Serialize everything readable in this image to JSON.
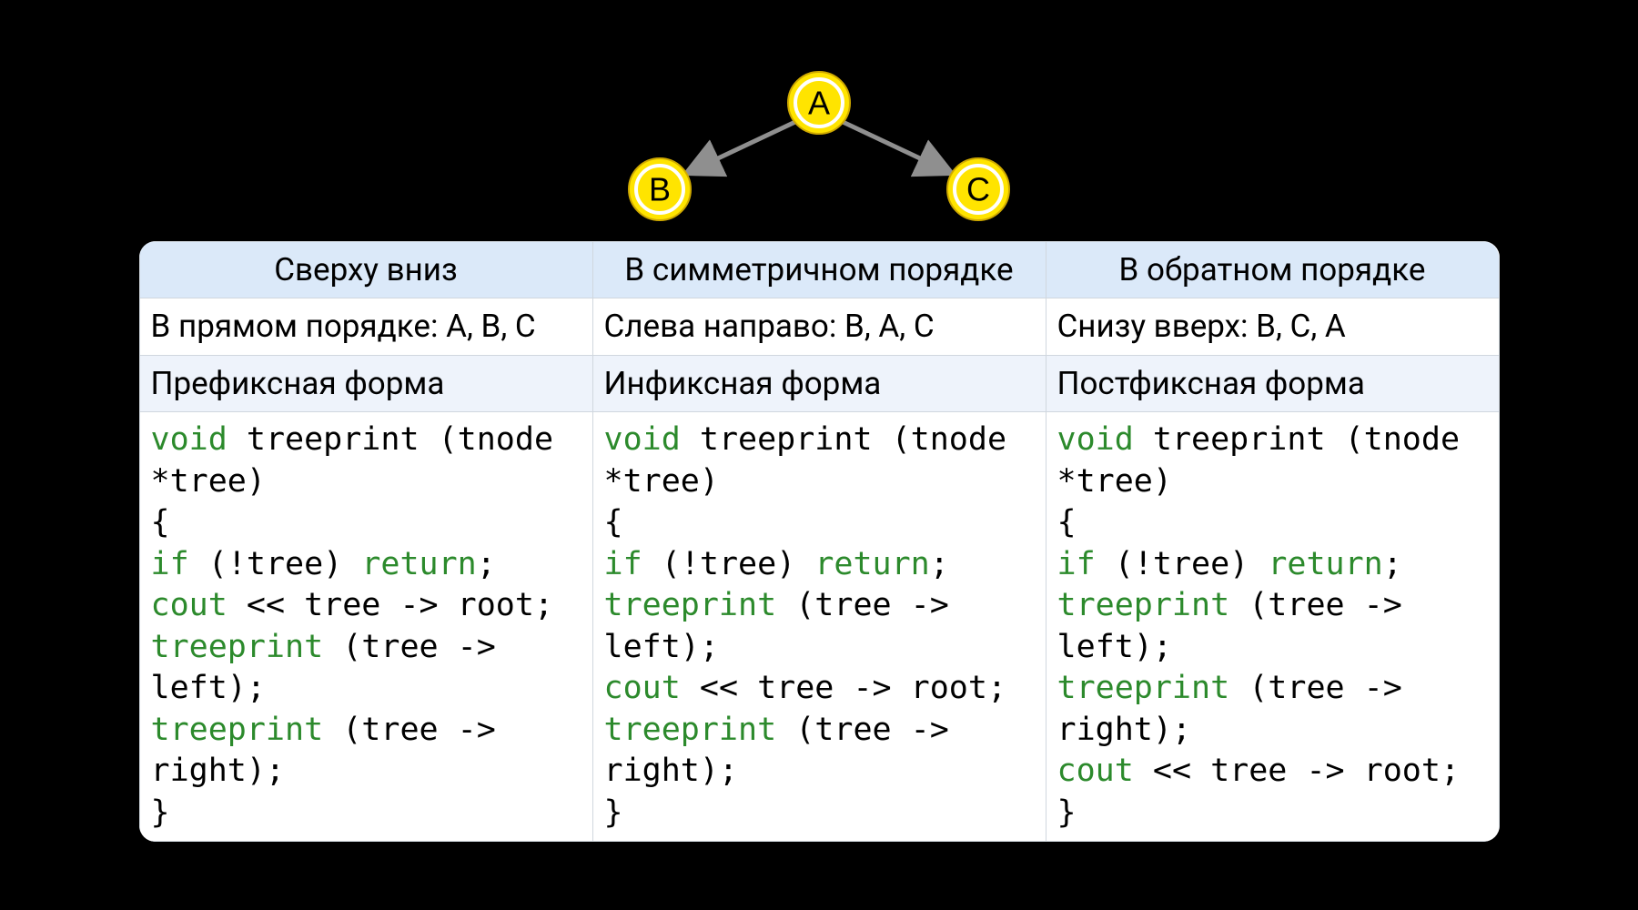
{
  "tree": {
    "root": "A",
    "left": "B",
    "right": "C"
  },
  "columns": [
    {
      "header": "Сверху вниз",
      "desc": "В прямом порядке: A, B, C",
      "form": "Префиксная форма",
      "code": {
        "l1a": "void",
        "l1b": " treeprint (tnode *tree)",
        "l2": "{",
        "l3a": "if",
        "l3b": " (!tree) ",
        "l3c": "return",
        "l3d": ";",
        "l4a": "cout",
        "l4b": " << tree -> root;",
        "l5a": "treeprint",
        "l5b": " (tree -> left);",
        "l6a": "treeprint",
        "l6b": " (tree -> right);",
        "l7": "}"
      }
    },
    {
      "header": "В симметричном порядке",
      "desc": "Слева направо: B, A, C",
      "form": "Инфиксная форма",
      "code": {
        "l1a": "void",
        "l1b": " treeprint (tnode *tree)",
        "l2": "{",
        "l3a": "if",
        "l3b": " (!tree) ",
        "l3c": "return",
        "l3d": ";",
        "l4a": "treeprint",
        "l4b": " (tree -> left);",
        "l5a": "cout",
        "l5b": " << tree -> root;",
        "l6a": "treeprint",
        "l6b": " (tree -> right);",
        "l7": "}"
      }
    },
    {
      "header": "В обратном порядке",
      "desc": "Снизу вверх: B, C, A",
      "form": "Постфиксная форма",
      "code": {
        "l1a": "void",
        "l1b": " treeprint (tnode *tree)",
        "l2": "{",
        "l3a": "if",
        "l3b": " (!tree) ",
        "l3c": "return",
        "l3d": ";",
        "l4a": "treeprint",
        "l4b": " (tree -> left);",
        "l5a": "treeprint",
        "l5b": " (tree -> right);",
        "l6a": "cout",
        "l6b": " << tree -> root;",
        "l7": "}"
      }
    }
  ]
}
